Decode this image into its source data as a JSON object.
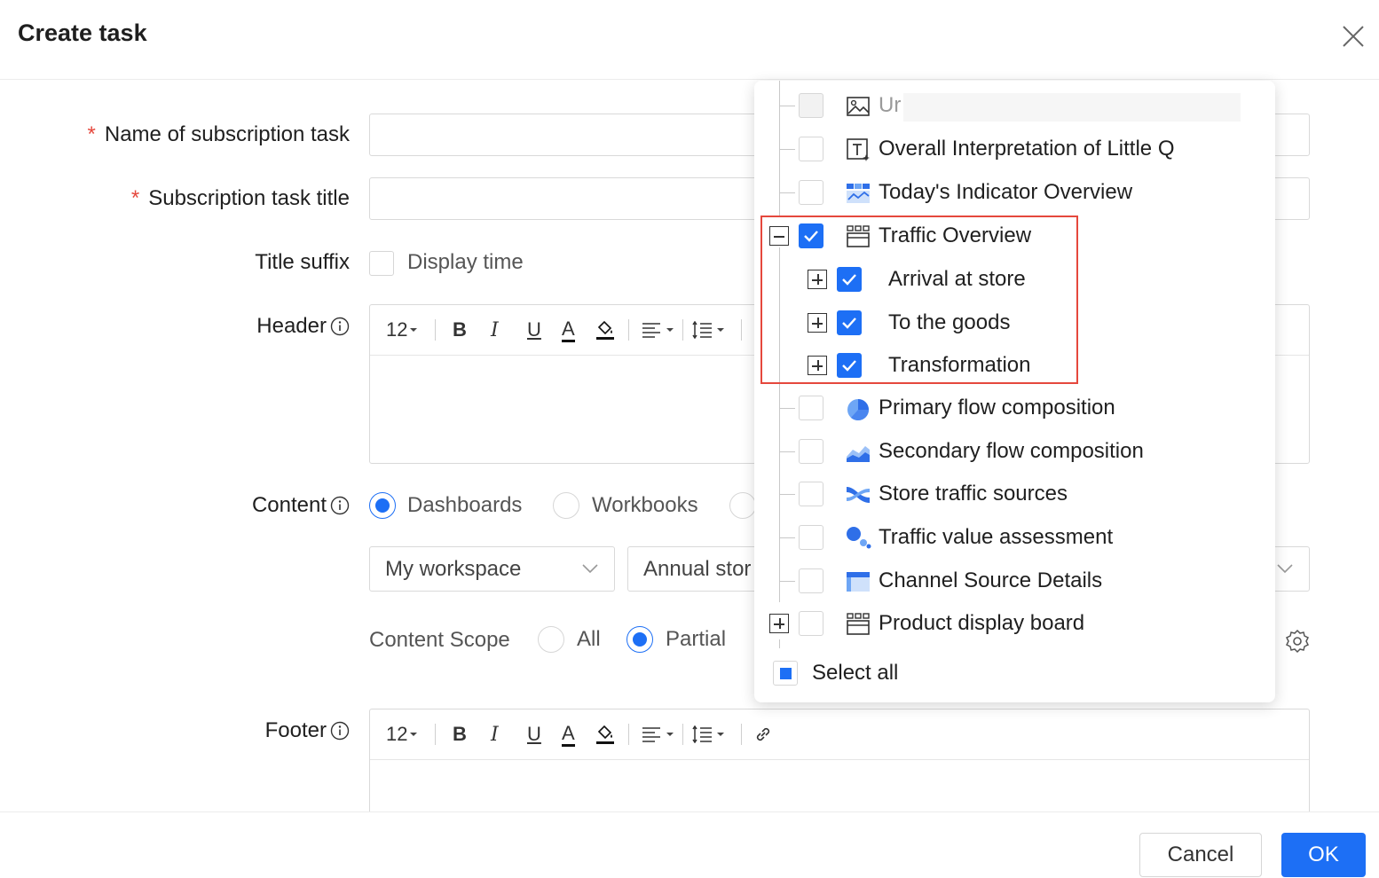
{
  "dialog": {
    "title": "Create task",
    "close_icon": "close-icon"
  },
  "form": {
    "name_label": "Name of subscription task",
    "title_label": "Subscription task title",
    "required_mark": "*",
    "suffix_label": "Title suffix",
    "suffix_option": "Display time",
    "header_label": "Header",
    "content_label": "Content",
    "footer_label": "Footer",
    "content_types": [
      "Dashboards",
      "Workbooks"
    ],
    "content_type_selected": "Dashboards",
    "workspace_value": "My workspace",
    "dashboard_value": "Annual stor",
    "scope_label": "Content Scope",
    "scope_options": [
      "All",
      "Partial"
    ],
    "scope_selected": "Partial"
  },
  "editor_toolbar": {
    "font_size": "12",
    "bold": "B",
    "italic": "I",
    "underline": "U",
    "font_color": "A"
  },
  "tree": {
    "items": [
      {
        "label": "Ur",
        "checked": false,
        "disabled": true,
        "icon": "image-icon"
      },
      {
        "label": "Overall Interpretation of Little Q",
        "checked": false,
        "icon": "text-icon"
      },
      {
        "label": "Today's Indicator Overview",
        "checked": false,
        "icon": "indicator-card-icon"
      },
      {
        "label": "Traffic Overview",
        "checked": true,
        "expanded": true,
        "icon": "container-icon"
      },
      {
        "label": "Arrival at store",
        "checked": true,
        "child": true
      },
      {
        "label": "To the goods",
        "checked": true,
        "child": true
      },
      {
        "label": "Transformation",
        "checked": true,
        "child": true
      },
      {
        "label": "Primary flow composition",
        "checked": false,
        "icon": "pie-chart-icon"
      },
      {
        "label": "Secondary flow composition",
        "checked": false,
        "icon": "area-chart-icon"
      },
      {
        "label": "Store traffic sources",
        "checked": false,
        "icon": "sankey-icon"
      },
      {
        "label": "Traffic value assessment",
        "checked": false,
        "icon": "bubble-chart-icon"
      },
      {
        "label": "Channel Source Details",
        "checked": false,
        "icon": "table-icon"
      },
      {
        "label": "Product display board",
        "checked": false,
        "expanded": false,
        "icon": "container-icon"
      }
    ],
    "select_all": "Select all"
  },
  "buttons": {
    "cancel": "Cancel",
    "ok": "OK"
  },
  "colors": {
    "primary": "#1d6ff5",
    "required": "#e5483d",
    "highlight_border": "#e5483d"
  }
}
